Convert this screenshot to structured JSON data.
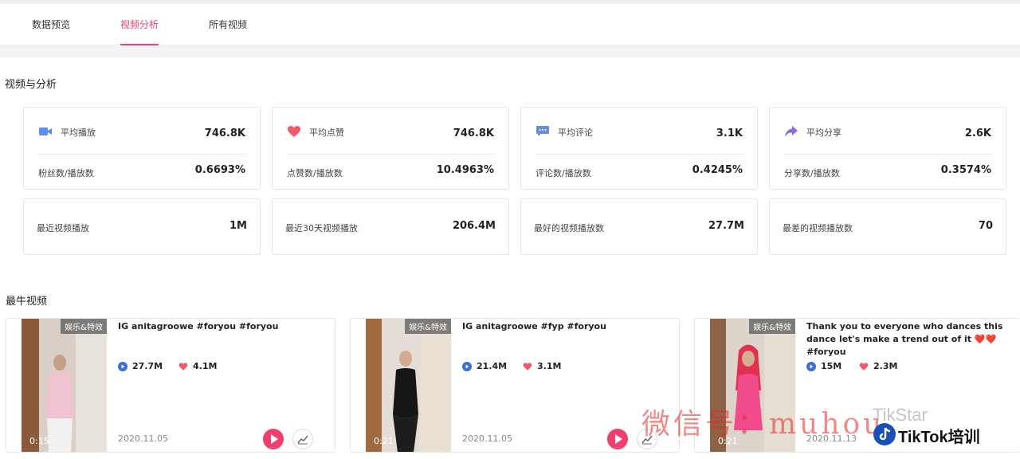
{
  "tabs": [
    "数据预览",
    "视频分析",
    "所有视频"
  ],
  "active_tab": "视频分析",
  "section_analysis": "视频与分析",
  "section_best": "最牛视频",
  "stats": [
    {
      "icon": "video-camera-icon",
      "color": "#5b8ee6",
      "label": "平均播放",
      "value": "746.8K",
      "sub_label": "粉丝数/播放数",
      "sub_value": "0.6693%"
    },
    {
      "icon": "heart-icon",
      "color": "#f05a6a",
      "label": "平均点赞",
      "value": "746.8K",
      "sub_label": "点赞数/播放数",
      "sub_value": "10.4963%"
    },
    {
      "icon": "comment-icon",
      "color": "#6a8fd8",
      "label": "平均评论",
      "value": "3.1K",
      "sub_label": "评论数/播放数",
      "sub_value": "0.4245%"
    },
    {
      "icon": "share-arrow-icon",
      "color": "#8a6ad8",
      "label": "平均分享",
      "value": "2.6K",
      "sub_label": "分享数/播放数",
      "sub_value": "0.3574%"
    }
  ],
  "kpis": [
    {
      "label": "最近视频播放",
      "value": "1M"
    },
    {
      "label": "最近30天视频播放",
      "value": "206.4M"
    },
    {
      "label": "最好的视频播放数",
      "value": "27.7M"
    },
    {
      "label": "最差的视频播放数",
      "value": "70"
    }
  ],
  "videos": [
    {
      "badge": "娱乐&特效",
      "duration": "0:15",
      "title": "IG anitagroowe #foryou #foryou",
      "plays": "27.7M",
      "likes": "4.1M",
      "date": "2020.11.05"
    },
    {
      "badge": "娱乐&特效",
      "duration": "0:21",
      "title": "IG anitagroowe #fyp #foryou",
      "plays": "21.4M",
      "likes": "3.1M",
      "date": "2020.11.05"
    },
    {
      "badge": "娱乐&特效",
      "duration": "0:21",
      "title": "Thank you to everyone who dances this dance let's make a trend out of it ❤️❤️ #foryou",
      "plays": "15M",
      "likes": "2.3M",
      "date": "2020.11.13"
    }
  ],
  "watermark": {
    "text": "微信号：muhou",
    "brand": "TikTok培训",
    "sub": "TikStar"
  },
  "colors": {
    "accent": "#f03f6c",
    "play_icon": "#3a6fd8",
    "like_icon": "#f05a6a"
  }
}
